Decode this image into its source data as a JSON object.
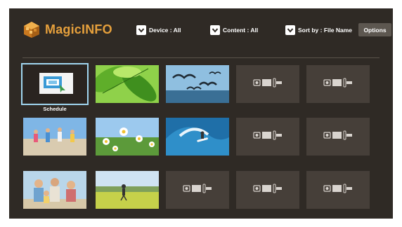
{
  "app": {
    "title": "MagicINFO",
    "brand_color": "#e6a03c",
    "logo_icon": "magicinfo-logo-icon"
  },
  "filters": [
    {
      "label": "Device : All"
    },
    {
      "label": "Content : All"
    },
    {
      "label": "Sort by : File Name"
    }
  ],
  "options_label": "Options",
  "grid": {
    "rows": [
      [
        {
          "kind": "schedule",
          "caption": "Schedule",
          "selected": true
        },
        {
          "kind": "photo",
          "subject": "green-leaves"
        },
        {
          "kind": "photo",
          "subject": "seagulls-over-sea"
        },
        {
          "kind": "empty",
          "icon": "media-placeholder-icon"
        },
        {
          "kind": "empty",
          "icon": "media-placeholder-icon"
        }
      ],
      [
        {
          "kind": "photo",
          "subject": "family-running-on-beach"
        },
        {
          "kind": "photo",
          "subject": "daisies-field"
        },
        {
          "kind": "photo",
          "subject": "surfer-on-wave"
        },
        {
          "kind": "empty",
          "icon": "media-placeholder-icon"
        },
        {
          "kind": "empty",
          "icon": "media-placeholder-icon"
        }
      ],
      [
        {
          "kind": "photo",
          "subject": "family-group"
        },
        {
          "kind": "photo",
          "subject": "child-in-field"
        },
        {
          "kind": "empty",
          "icon": "media-placeholder-icon"
        },
        {
          "kind": "empty",
          "icon": "media-placeholder-icon"
        },
        {
          "kind": "empty",
          "icon": "media-placeholder-icon"
        }
      ]
    ]
  }
}
